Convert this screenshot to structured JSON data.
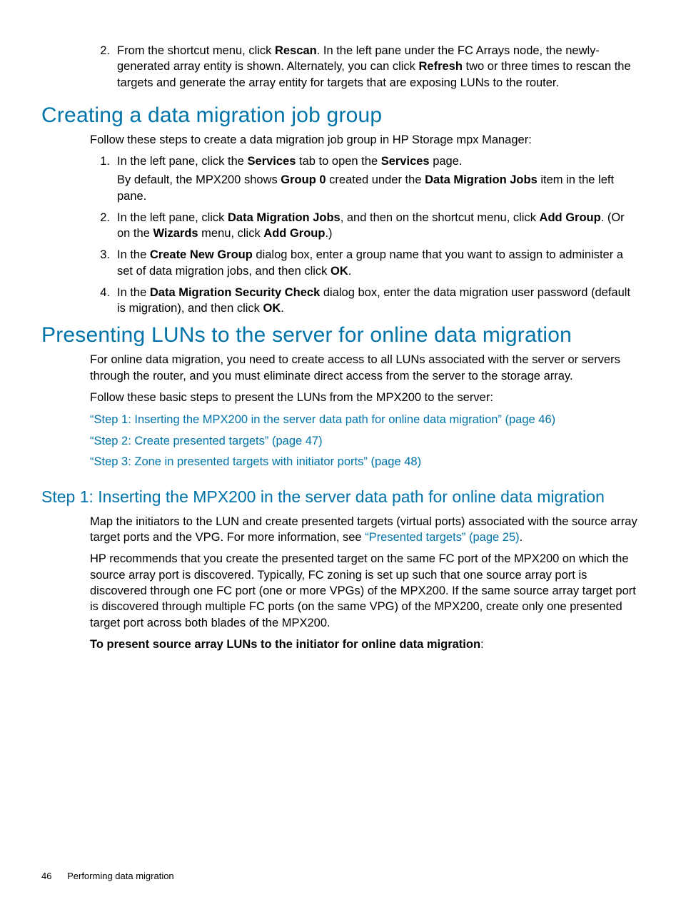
{
  "intro_list": {
    "item2": {
      "num": "2.",
      "pre": "From the shortcut menu, click ",
      "bold1": "Rescan",
      "mid1": ". In the left pane under the FC Arrays node, the newly-generated array entity is shown. Alternately, you can click ",
      "bold2": "Refresh",
      "post": " two or three times to rescan the targets and generate the array entity for targets that are exposing LUNs to the router."
    }
  },
  "section1": {
    "heading": "Creating a data migration job group",
    "intro": "Follow these steps to create a data migration job group in HP Storage mpx Manager:",
    "items": {
      "i1": {
        "num": "1.",
        "p1_pre": "In the left pane, click the ",
        "p1_b1": "Services",
        "p1_mid": " tab to open the ",
        "p1_b2": "Services",
        "p1_post": " page.",
        "p2_pre": "By default, the MPX200 shows ",
        "p2_b1": "Group 0",
        "p2_mid": " created under the ",
        "p2_b2": "Data Migration Jobs",
        "p2_post": " item in the left pane."
      },
      "i2": {
        "num": "2.",
        "pre": "In the left pane, click ",
        "b1": "Data Migration Jobs",
        "mid1": ", and then on the shortcut menu, click ",
        "b2": "Add Group",
        "mid2": ". (Or on the ",
        "b3": "Wizards",
        "mid3": " menu, click ",
        "b4": "Add Group",
        "post": ".)"
      },
      "i3": {
        "num": "3.",
        "pre": "In the ",
        "b1": "Create New Group",
        "mid1": " dialog box, enter a group name that you want to assign to administer a set of data migration jobs, and then click ",
        "b2": "OK",
        "post": "."
      },
      "i4": {
        "num": "4.",
        "pre": "In the ",
        "b1": "Data Migration Security Check",
        "mid1": " dialog box, enter the data migration user password (default is migration), and then click ",
        "b2": "OK",
        "post": "."
      }
    }
  },
  "section2": {
    "heading": "Presenting LUNs to the server for online data migration",
    "para1": "For online data migration, you need to create access to all LUNs associated with the server or servers through the router, and you must eliminate direct access from the server to the storage array.",
    "para2": "Follow these basic steps to present the LUNs from the MPX200 to the server:",
    "link1": "“Step 1: Inserting the MPX200 in the server data path for online data migration” (page 46)",
    "link2": "“Step 2: Create presented targets” (page 47)",
    "link3": "“Step 3: Zone in presented targets with initiator ports” (page 48)",
    "sub": {
      "heading": "Step 1: Inserting the MPX200 in the server data path for online data migration",
      "p1_pre": "Map the initiators to the LUN and create presented targets (virtual ports) associated with the source array target ports and the VPG. For more information, see ",
      "p1_link": "“Presented targets” (page 25)",
      "p1_post": ".",
      "p2": "HP recommends that you create the presented target on the same FC port of the MPX200 on which the source array port is discovered. Typically, FC zoning is set up such that one source array port is discovered through one FC port (one or more VPGs) of the MPX200. If the same source array target port is discovered through multiple FC ports (on the same VPG) of the MPX200, create only one presented target port across both blades of the MPX200.",
      "p3_bold": "To present source array LUNs to the initiator for online data migration",
      "p3_post": ":"
    }
  },
  "footer": {
    "page": "46",
    "title": "Performing data migration"
  }
}
